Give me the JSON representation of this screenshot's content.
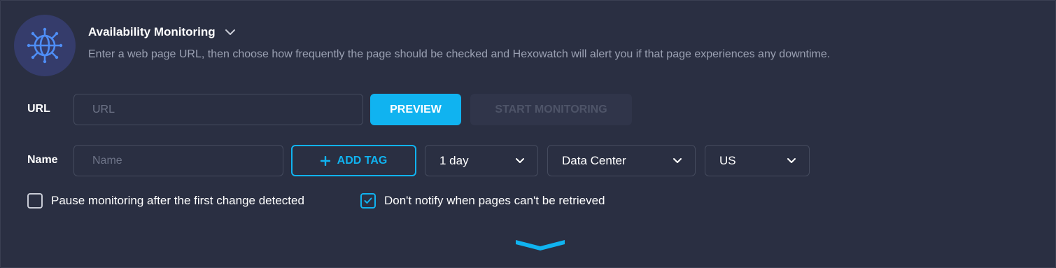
{
  "header": {
    "title": "Availability Monitoring",
    "description": "Enter a web page URL, then choose how frequently the page should be checked and Hexowatch will alert you if that page experiences any downtime.",
    "logo_icon": "globe-icon",
    "title_dropdown_icon": "chevron-down-icon"
  },
  "url_row": {
    "label": "URL",
    "placeholder": "URL",
    "value": "",
    "preview_label": "PREVIEW",
    "start_label": "START MONITORING"
  },
  "name_row": {
    "label": "Name",
    "placeholder": "Name",
    "value": "",
    "add_tag_label": "ADD TAG",
    "add_tag_icon": "plus-icon",
    "frequency": "1 day",
    "location_type": "Data Center",
    "country": "US"
  },
  "options": {
    "pause_label": "Pause monitoring after the first change detected",
    "pause_checked": false,
    "no_notify_label": "Don't notify when pages can't be retrieved",
    "no_notify_checked": true
  },
  "footer": {
    "expand_icon": "chevron-down-icon"
  },
  "colors": {
    "background": "#2a2f42",
    "accent": "#10b3f0",
    "logo_bg": "#353c6b",
    "logo_icon": "#4e8df5",
    "muted_text": "#9aa0b2",
    "disabled_text": "#4e5468",
    "border": "#454b5e"
  }
}
